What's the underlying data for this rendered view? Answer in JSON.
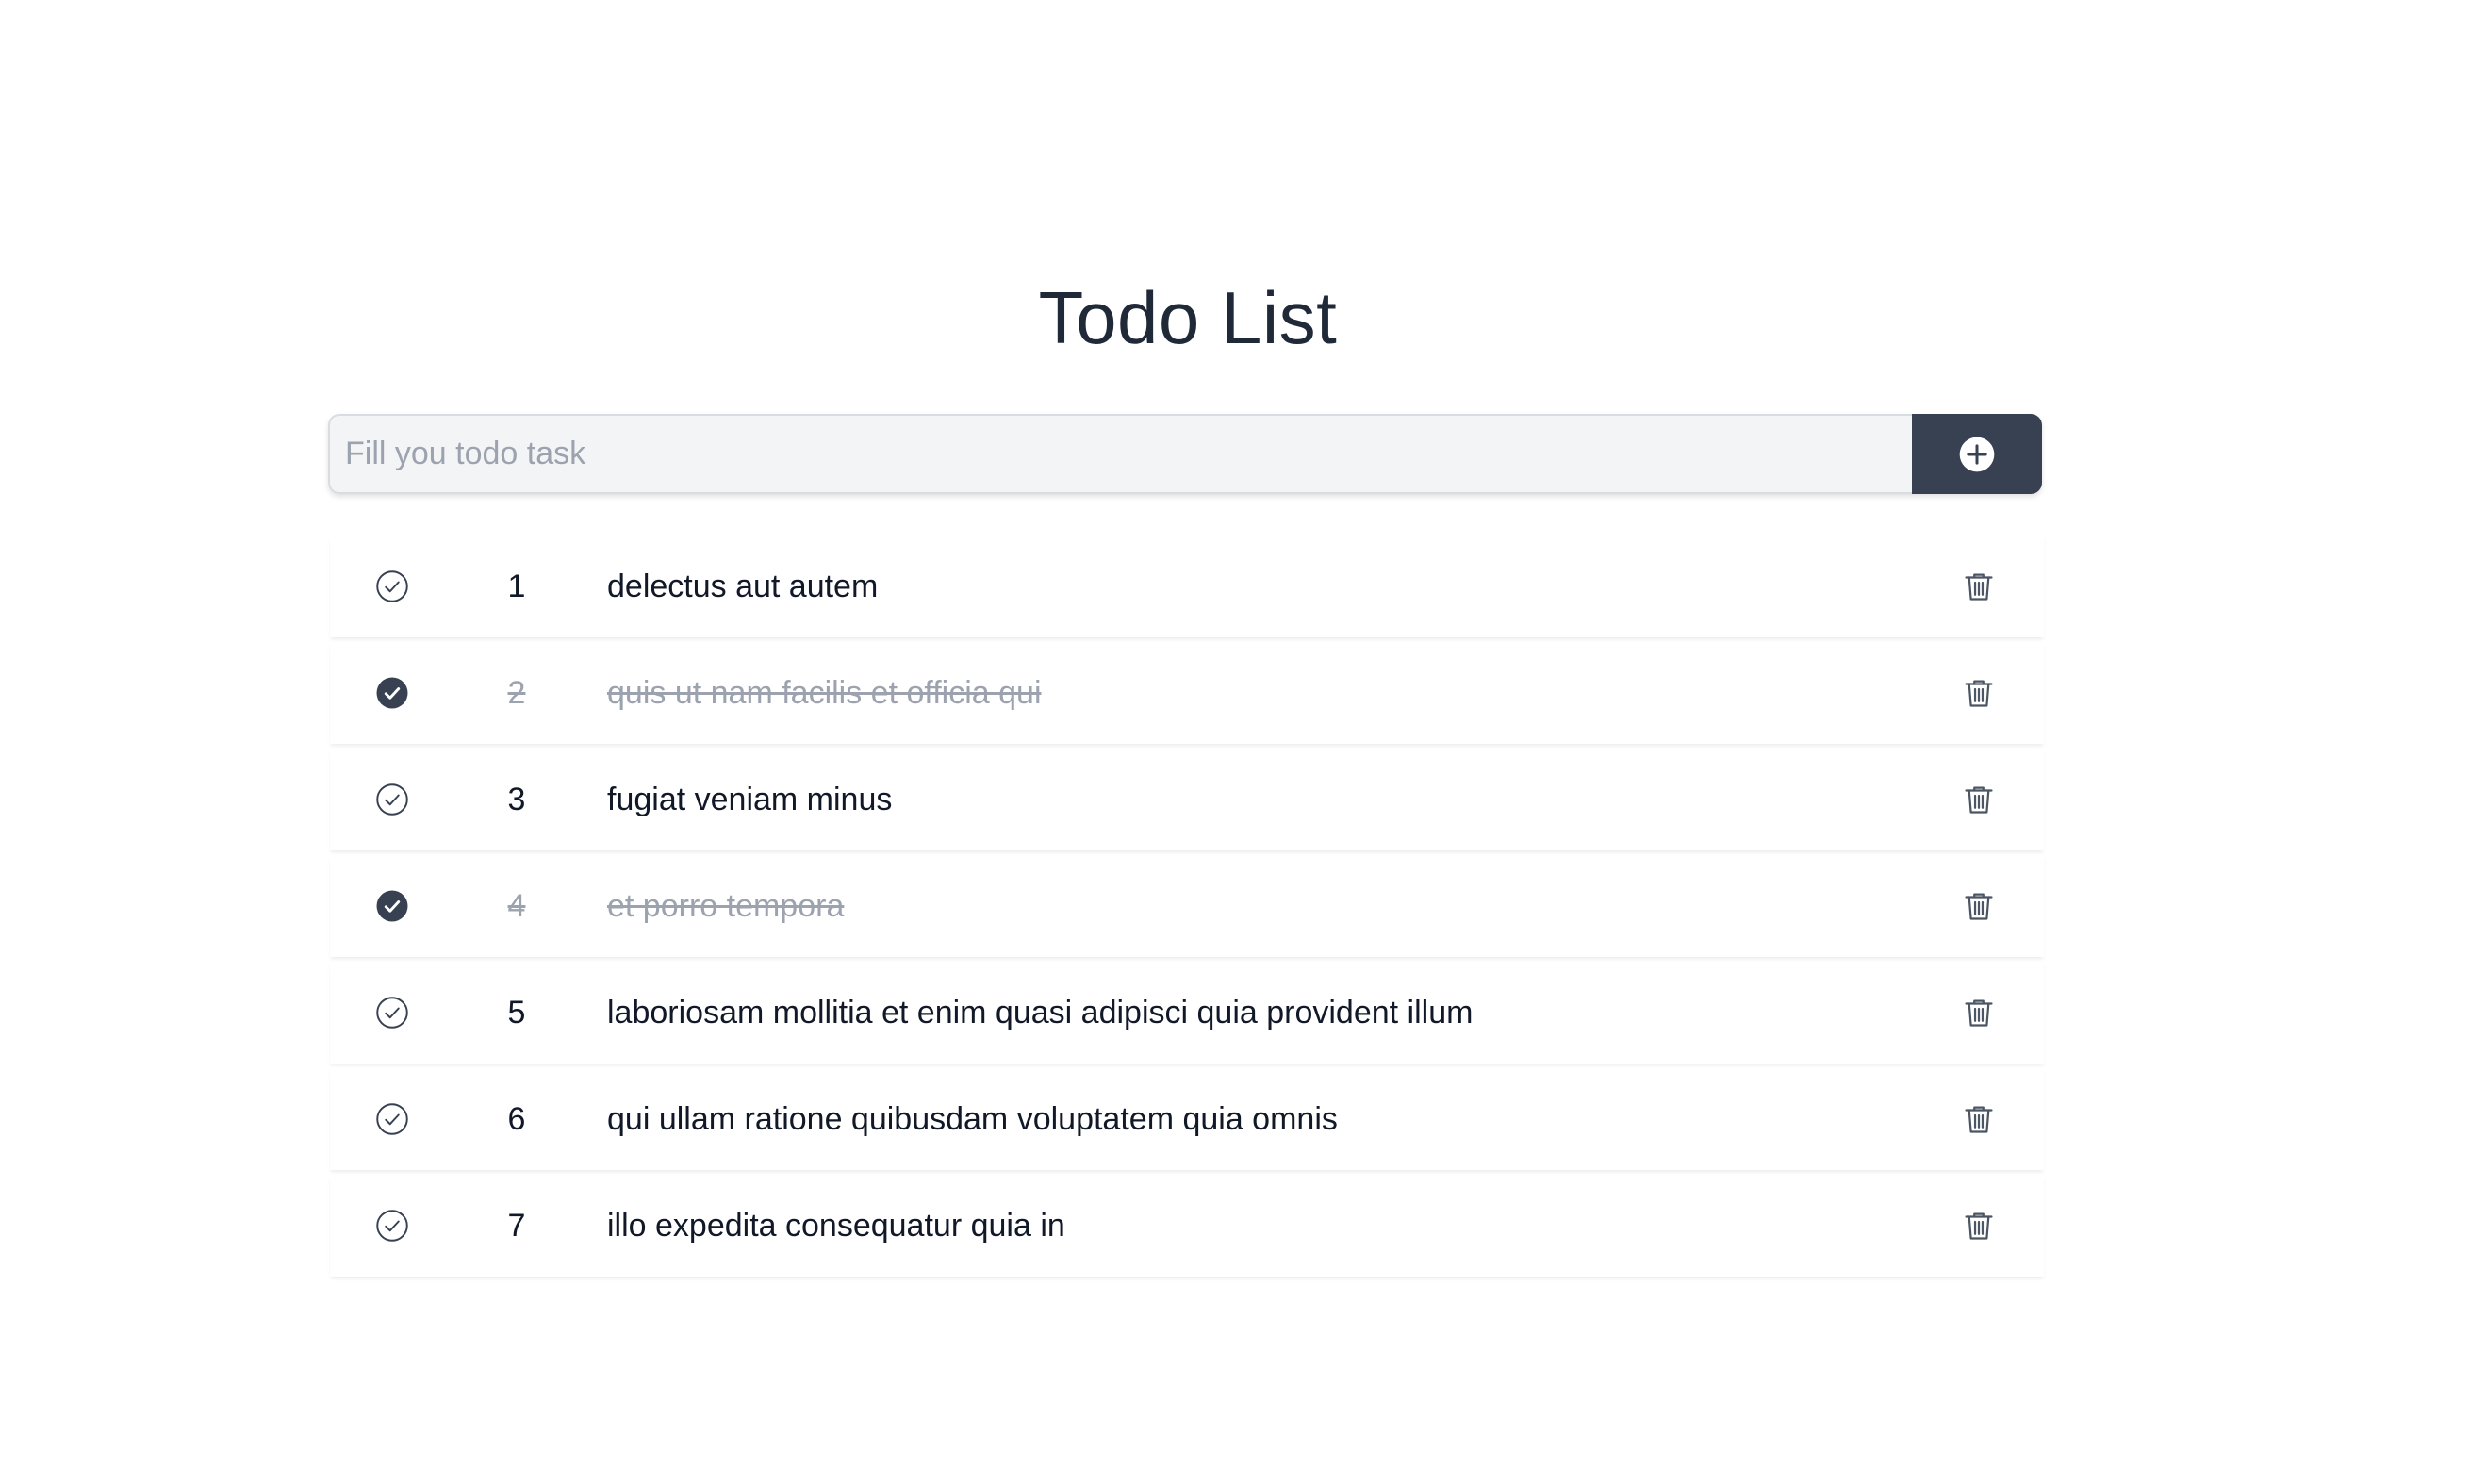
{
  "page": {
    "title": "Todo List"
  },
  "input": {
    "value": "",
    "placeholder": "Fill you todo task"
  },
  "add_button": {
    "icon": "plus-circle-icon"
  },
  "colors": {
    "accent": "#374151",
    "done_text": "#9ca3af",
    "input_bg": "#f3f4f6"
  },
  "todos": [
    {
      "number": "1",
      "text": "delectus aut autem",
      "completed": false
    },
    {
      "number": "2",
      "text": "quis ut nam facilis et officia qui",
      "completed": true
    },
    {
      "number": "3",
      "text": "fugiat veniam minus",
      "completed": false
    },
    {
      "number": "4",
      "text": "et porro tempora",
      "completed": true
    },
    {
      "number": "5",
      "text": "laboriosam mollitia et enim quasi adipisci quia provident illum",
      "completed": false
    },
    {
      "number": "6",
      "text": "qui ullam ratione quibusdam voluptatem quia omnis",
      "completed": false
    },
    {
      "number": "7",
      "text": "illo expedita consequatur quia in",
      "completed": false
    }
  ]
}
